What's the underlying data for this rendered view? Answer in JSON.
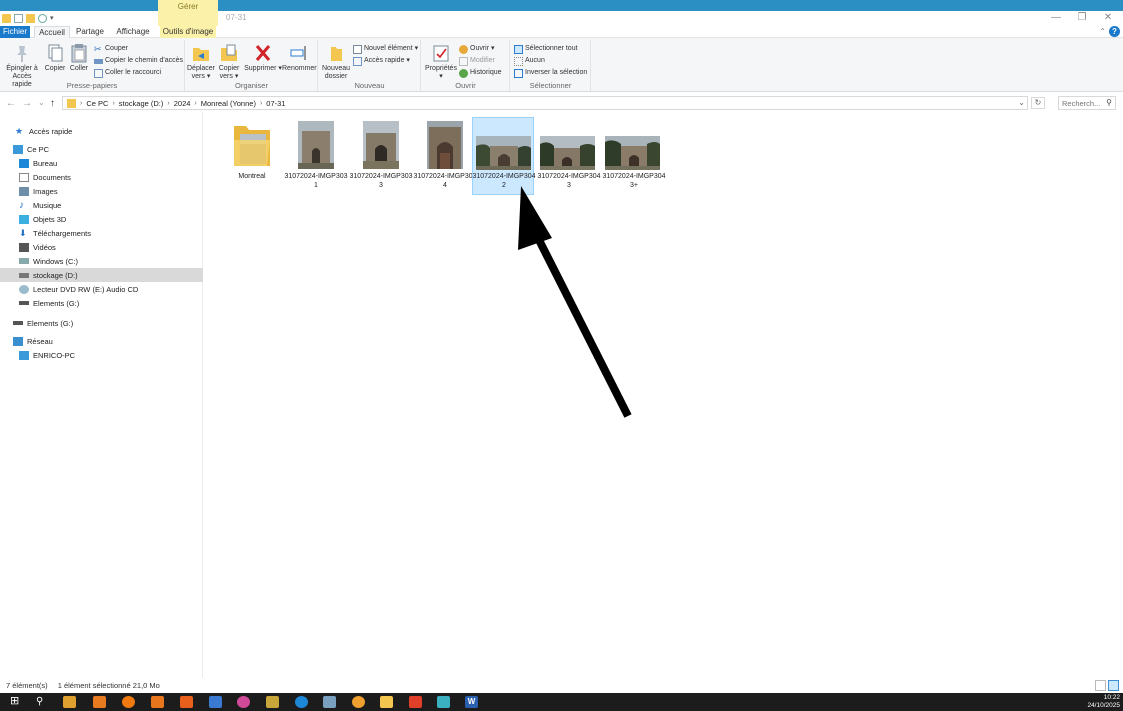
{
  "titlebar": {
    "manage_label": "Gérer",
    "window_title": "07-31",
    "minimize": "—",
    "maximize": "❐",
    "close": "✕"
  },
  "tabs": {
    "file": "Fichier",
    "home": "Accueil",
    "share": "Partage",
    "view": "Affichage",
    "picture_tools": "Outils d'image",
    "help": "?",
    "ribbon_toggle": "⌃"
  },
  "ribbon": {
    "clipboard": {
      "label": "Presse-papiers",
      "pin": "Épingler à Accès rapide",
      "copy": "Copier",
      "paste": "Coller",
      "cut": "Couper",
      "copy_path": "Copier le chemin d'accès",
      "paste_shortcut": "Coller le raccourci"
    },
    "organize": {
      "label": "Organiser",
      "move_to": "Déplacer vers ▾",
      "copy_to": "Copier vers ▾",
      "delete": "Supprimer ▾",
      "rename": "Renommer"
    },
    "new": {
      "label": "Nouveau",
      "new_folder": "Nouveau dossier",
      "new_item": "Nouvel élément ▾",
      "easy_access": "Accès rapide ▾"
    },
    "open": {
      "label": "Ouvrir",
      "properties": "Propriétés ▾",
      "open": "Ouvrir ▾",
      "edit": "Modifier",
      "history": "Historique"
    },
    "select": {
      "label": "Sélectionner",
      "select_all": "Sélectionner tout",
      "select_none": "Aucun",
      "invert": "Inverser la sélection"
    }
  },
  "address": {
    "back": "←",
    "forward": "→",
    "recent": "⌄",
    "up": "↑",
    "crumbs": [
      "Ce PC",
      "stockage (D:)",
      "2024",
      "Monreal (Yonne)",
      "07-31"
    ],
    "search_placeholder": "Recherch...",
    "search_icon": "⚲",
    "refresh_icon": "↻",
    "dropdown_icon": "⌄"
  },
  "nav": {
    "quick_access": "Accès rapide",
    "this_pc": "Ce PC",
    "desktop": "Bureau",
    "documents": "Documents",
    "pictures": "Images",
    "music": "Musique",
    "objects3d": "Objets 3D",
    "downloads": "Téléchargements",
    "videos": "Vidéos",
    "windows_c": "Windows (C:)",
    "storage_d": "stockage (D:)",
    "dvd_e": "Lecteur DVD RW (E:) Audio CD",
    "elements_g": "Elements (G:)",
    "elements_g2": "Elements (G:)",
    "network": "Réseau",
    "pc_enrico": "ENRICO-PC"
  },
  "files": [
    {
      "name": "Montreal",
      "kind": "folder",
      "selected": false
    },
    {
      "name": "31072024-IMGP3031",
      "kind": "photo",
      "selected": false
    },
    {
      "name": "31072024-IMGP3033",
      "kind": "photo",
      "selected": false
    },
    {
      "name": "31072024-IMGP3034",
      "kind": "photo",
      "selected": false
    },
    {
      "name": "31072024-IMGP3042",
      "kind": "photo",
      "selected": true
    },
    {
      "name": "31072024-IMGP3043",
      "kind": "photo",
      "selected": false
    },
    {
      "name": "31072024-IMGP3043+",
      "kind": "photo",
      "selected": false
    }
  ],
  "status": {
    "count": "7 élément(s)",
    "selection": "1 élément sélectionné  21,0 Mo"
  },
  "clock": {
    "time": "10:22",
    "date": "24/10/2025"
  },
  "colors": {
    "accent": "#1979ca",
    "selection": "#cce8ff",
    "manage_tab": "#fbf1a8",
    "taskbar": "#1c1c1c"
  }
}
